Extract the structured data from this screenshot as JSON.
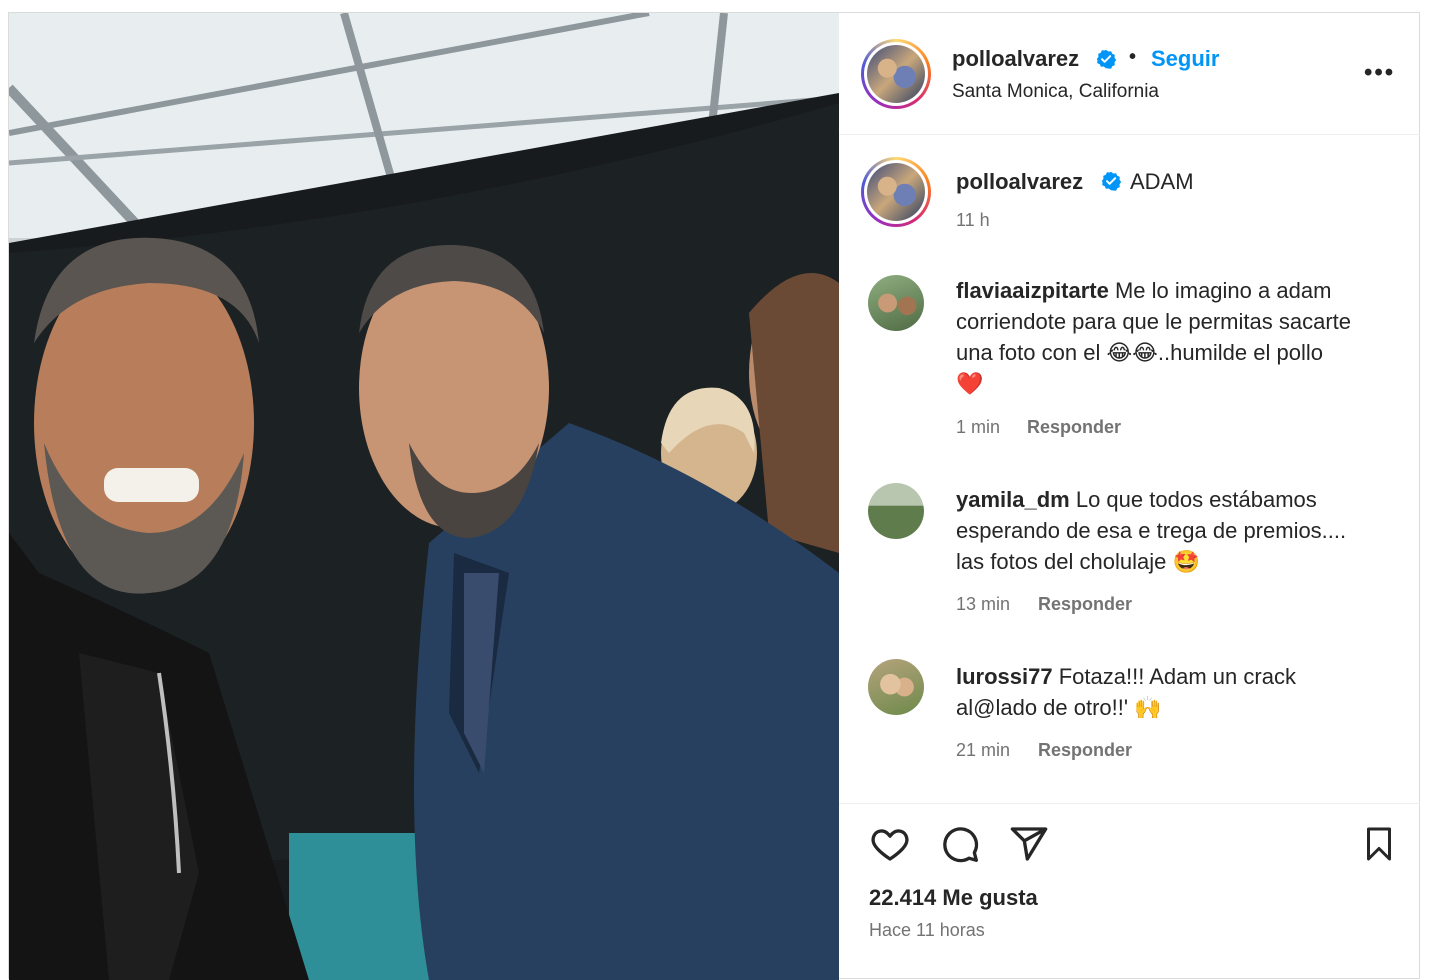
{
  "post": {
    "username": "polloalvarez",
    "dot": "•",
    "follow_label": "Seguir",
    "location": "Santa Monica, California",
    "more_label": "•••",
    "photo_alt": "selfie"
  },
  "caption": {
    "username": "polloalvarez",
    "text": "ADAM",
    "time": "11 h"
  },
  "comments": [
    {
      "username": "flaviaaizpitarte",
      "text_lines": [
        "Me lo imagino a adam",
        "corriendote para que le permitas sacarte",
        "una foto con el 😂😂..humilde el pollo",
        "❤️"
      ],
      "time": "1 min",
      "reply": "Responder"
    },
    {
      "username": "yamila_dm",
      "text_lines": [
        "Lo que todos estábamos",
        "esperando de esa e trega de premios....",
        "las fotos del cholulaje 🤩"
      ],
      "time": "13 min",
      "reply": "Responder"
    },
    {
      "username": "lurossi77",
      "text_lines": [
        "Fotaza!!! Adam un crack",
        "al@lado de otro!!' 🙌"
      ],
      "time": "21 min",
      "reply": "Responder"
    }
  ],
  "likes": "22.414 Me gusta",
  "time_ago": "Hace 11 horas",
  "colors": {
    "accent": "#0095f6",
    "verified": "#0095f6",
    "muted": "#737373"
  }
}
